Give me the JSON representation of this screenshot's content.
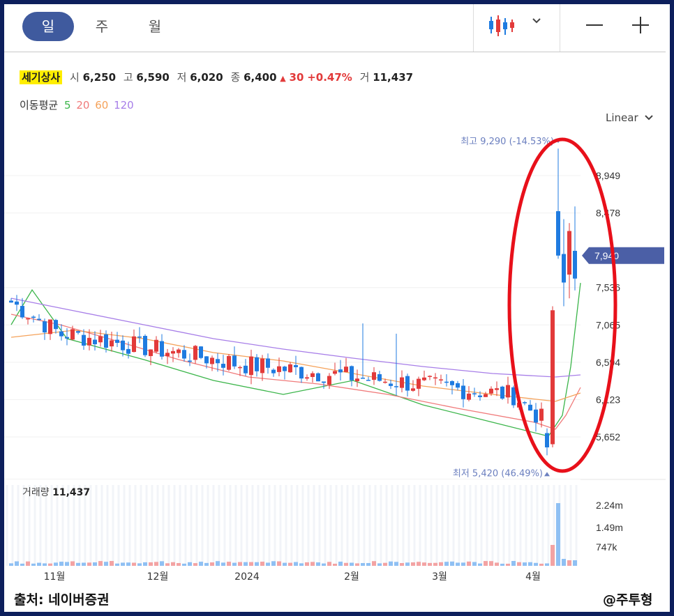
{
  "periods": [
    "일",
    "주",
    "월"
  ],
  "active_period": "일",
  "info": {
    "name": "세기상사",
    "open_label": "시",
    "open": "6,250",
    "high_label": "고",
    "high": "6,590",
    "low_label": "저",
    "low": "6,020",
    "close_label": "종",
    "close": "6,400",
    "change_arrow": "▲",
    "change": "30",
    "change_pct": "+0.47%",
    "volume_label": "거",
    "volume": "11,437"
  },
  "ma": {
    "label": "이동평균",
    "periods": [
      "5",
      "20",
      "60",
      "120"
    ],
    "colors": [
      "#3bb54a",
      "#f07a7a",
      "#f5a25a",
      "#a77ee8"
    ]
  },
  "scale_mode": "Linear",
  "chart_data": {
    "type": "candlestick",
    "y_ticks": [
      5652,
      6123,
      6594,
      7065,
      7536,
      8478,
      8949
    ],
    "y_tick_labels": [
      "5,652",
      "6,123",
      "6,594",
      "7,065",
      "7,536",
      "8,478",
      "8,949"
    ],
    "current_price_label": "7,940",
    "current_price": 7940,
    "high_marker": {
      "label": "최고 9,290 (-14.53%)",
      "value": 9290
    },
    "low_marker": {
      "label": "최저 5,420 (46.49%)",
      "value": 5420
    },
    "x_ticks": [
      "11월",
      "12월",
      "2024",
      "2월",
      "3월",
      "4월"
    ],
    "volume_label": "거래량",
    "volume_value": "11,437",
    "volume_ticks": [
      "2.24m",
      "1.49m",
      "747k"
    ],
    "up_color": "#e23a3a",
    "down_color": "#1f7be0"
  },
  "annotation_color": "#e8101a",
  "source": "출처: 네이버증권",
  "credit": "@주투형"
}
